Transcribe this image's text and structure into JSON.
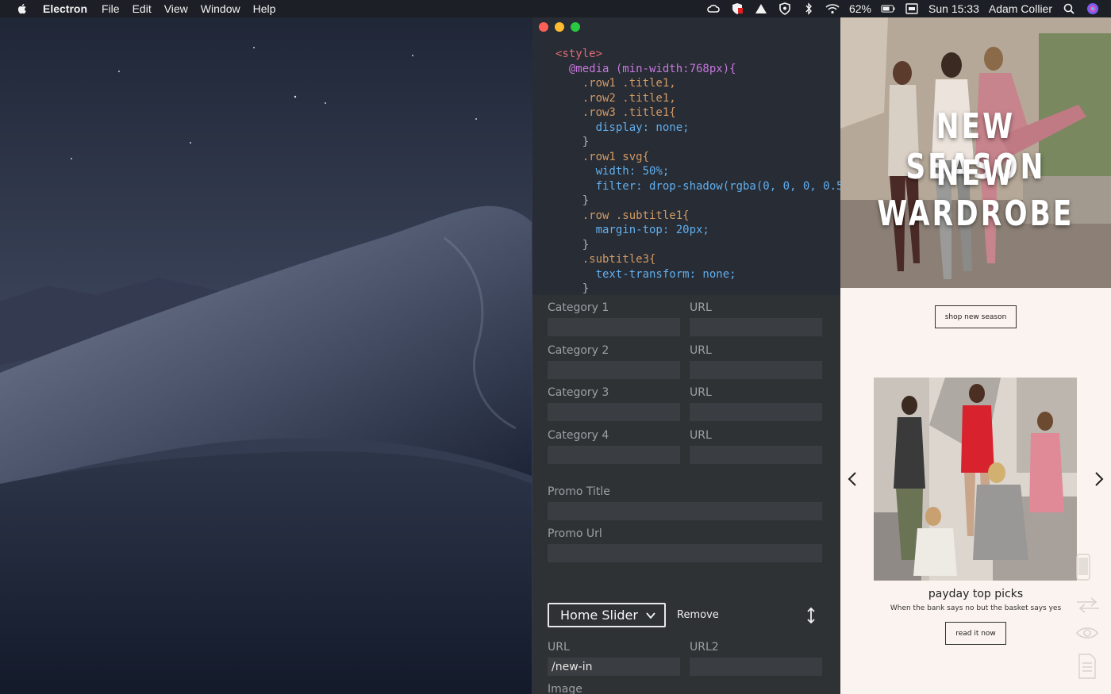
{
  "menubar": {
    "app_name": "Electron",
    "menus": [
      "File",
      "Edit",
      "View",
      "Window",
      "Help"
    ],
    "battery": "62%",
    "clock": "Sun 15:33",
    "user": "Adam Collier"
  },
  "code": {
    "lines": [
      "<style>",
      "  @media (min-width:768px){",
      "    .row1 .title1,",
      "    .row2 .title1,",
      "    .row3 .title1{",
      "      display: none;",
      "    }",
      "    .row1 svg{",
      "      width: 50%;",
      "      filter: drop-shadow(rgba(0, 0, 0, 0.5)",
      "    }",
      "    .row .subtitle1{",
      "      margin-top: 20px;",
      "    }",
      "    .subtitle3{",
      "      text-transform: none;",
      "    }"
    ]
  },
  "form": {
    "category_labels": [
      "Category 1",
      "Category 2",
      "Category 3",
      "Category 4"
    ],
    "url_label": "URL",
    "promo_title_label": "Promo Title",
    "promo_url_label": "Promo Url",
    "section_select": "Home Slider",
    "remove_label": "Remove",
    "url_field_label": "URL",
    "url2_field_label": "URL2",
    "url_value": "/new-in",
    "image_label": "Image"
  },
  "preview": {
    "hero_line1": "NEW SEASON",
    "hero_line2": "NEW WARDROBE",
    "shop_button": "shop new season",
    "promo_title": "payday top picks",
    "promo_subtitle": "When the bank says no but the basket says yes",
    "read_button": "read it now"
  }
}
